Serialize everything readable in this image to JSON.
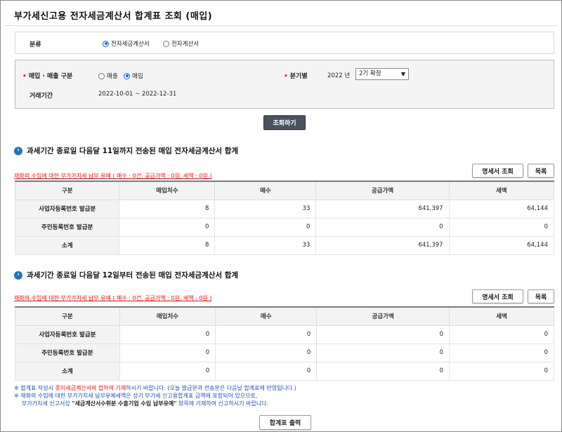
{
  "page": {
    "title": "부가세신고용 전자세금계산서 합계표 조회 (매입)"
  },
  "category": {
    "label": "분류",
    "options": [
      {
        "label": "전자세금계산서",
        "selected": true
      },
      {
        "label": "전자계산서",
        "selected": false
      }
    ]
  },
  "conditions": {
    "trade_type_label": "매입 · 매출 구분",
    "trade_options": [
      {
        "label": "매출",
        "selected": false
      },
      {
        "label": "매입",
        "selected": true
      }
    ],
    "quarter_label": "분기별",
    "year_value": "2022",
    "year_unit": "년",
    "quarter_selected": "2기 확정",
    "period_label": "거래기간",
    "period_value": "2022-10-01 ~ 2022-12-31"
  },
  "search_button": "조회하기",
  "sections": [
    {
      "title": "과세기간 종료일 다음달 11일까지 전송된 매입 전자세금계산서 합계",
      "warning": "재화의 수입에 대한 부가가치세 납부 유예 ( 매수 : 0건, 공급가액 : 0원, 세액 : 0원 )",
      "detail_button": "명세서 조회",
      "list_button": "목록",
      "headers": [
        "구분",
        "매입처수",
        "매수",
        "공급가액",
        "세액"
      ],
      "rows": [
        {
          "label": "사업자등록번호 발급분",
          "vendors": "8",
          "count": "33",
          "supply": "641,397",
          "tax": "64,144"
        },
        {
          "label": "주민등록번호 발급분",
          "vendors": "0",
          "count": "0",
          "supply": "0",
          "tax": "0"
        },
        {
          "label": "소계",
          "vendors": "8",
          "count": "33",
          "supply": "641,397",
          "tax": "64,144"
        }
      ]
    },
    {
      "title": "과세기간 종료일 다음달 12일부터 전송된 매입 전자세금계산서 합계",
      "warning": "재화의 수입에 대한 부가가치세 납부 유예 ( 매수 : 0건, 공급가액 : 0원, 세액 : 0원 )",
      "detail_button": "명세서 조회",
      "list_button": "목록",
      "headers": [
        "구분",
        "매입처수",
        "매수",
        "공급가액",
        "세액"
      ],
      "rows": [
        {
          "label": "사업자등록번호 발급분",
          "vendors": "0",
          "count": "0",
          "supply": "0",
          "tax": "0"
        },
        {
          "label": "주민등록번호 발급분",
          "vendors": "0",
          "count": "0",
          "supply": "0",
          "tax": "0"
        },
        {
          "label": "소계",
          "vendors": "0",
          "count": "0",
          "supply": "0",
          "tax": "0"
        }
      ]
    }
  ],
  "notes": {
    "line1_a": "※ 합계표 작성시 ",
    "line1_b": "종이세금계산서와 합하여 기재",
    "line1_c": "하시기 바랍니다. (오늘 발급분과 전송분은 다음날 합계표에 반영됩니다.)",
    "line2": "※ 재화의 수입에 대한 부가가치세 납부유예세액은 상기 부가세 신고용합계표 금액에 포함되어 있으므로,",
    "line3_a": "부가가치세 신고서상 ",
    "line3_b": "\"세금계산서수취분 수출기업 수입 납부유예\"",
    "line3_c": " 항목에 기재하여 신고하시기 바랍니다."
  },
  "print_button": "합계표 출력",
  "colors": {
    "accent": "#2473b5",
    "warning": "#dd1111",
    "note": "#1f4fb0"
  }
}
